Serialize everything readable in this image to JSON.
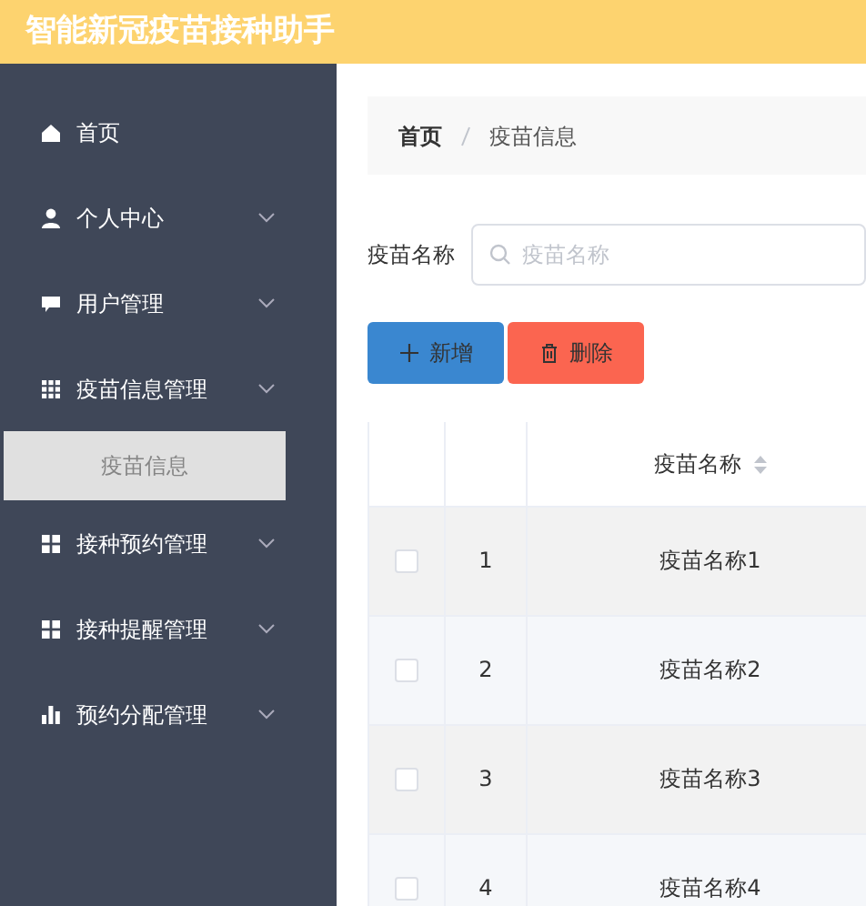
{
  "header": {
    "title": "智能新冠疫苗接种助手"
  },
  "sidebar": {
    "items": [
      {
        "label": "首页",
        "kind": "home",
        "expandable": false,
        "selected": false
      },
      {
        "label": "个人中心",
        "kind": "user",
        "expandable": true,
        "selected": false
      },
      {
        "label": "用户管理",
        "kind": "chat",
        "expandable": true,
        "selected": false
      },
      {
        "label": "疫苗信息管理",
        "kind": "grid9",
        "expandable": true,
        "selected": false,
        "children": [
          {
            "label": "疫苗信息",
            "selected": true
          }
        ]
      },
      {
        "label": "接种预约管理",
        "kind": "grid4",
        "expandable": true,
        "selected": false
      },
      {
        "label": "接种提醒管理",
        "kind": "grid4",
        "expandable": true,
        "selected": false
      },
      {
        "label": "预约分配管理",
        "kind": "bars",
        "expandable": true,
        "selected": false
      }
    ]
  },
  "breadcrumb": [
    "首页",
    "疫苗信息"
  ],
  "search": {
    "label": "疫苗名称",
    "placeholder": "疫苗名称"
  },
  "buttons": [
    {
      "label": "新增",
      "kind": "add"
    },
    {
      "label": "删除",
      "kind": "delete"
    }
  ],
  "table": {
    "columns": [
      "疫苗名称"
    ],
    "rows": [
      {
        "checked": false,
        "index": "1",
        "name": "疫苗名称1"
      },
      {
        "checked": false,
        "index": "2",
        "name": "疫苗名称2"
      },
      {
        "checked": false,
        "index": "3",
        "name": "疫苗名称3"
      },
      {
        "checked": false,
        "index": "4",
        "name": "疫苗名称4"
      }
    ]
  }
}
